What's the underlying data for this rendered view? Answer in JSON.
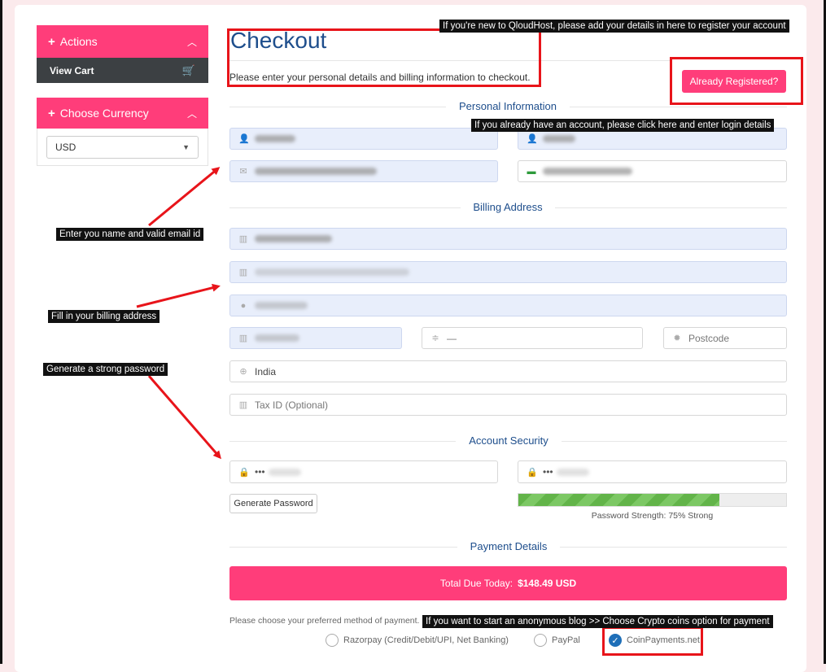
{
  "sidebar": {
    "actions_label": "Actions",
    "view_cart_label": "View Cart",
    "currency_label": "Choose Currency",
    "currency_value": "USD"
  },
  "main": {
    "title": "Checkout",
    "subtitle": "Please enter your personal details and billing information to checkout.",
    "already_registered": "Already Registered?",
    "sections": {
      "personal": "Personal Information",
      "billing": "Billing Address",
      "security": "Account Security",
      "payment": "Payment Details"
    },
    "fields": {
      "state_value": "—",
      "postcode_placeholder": "Postcode",
      "country_value": "India",
      "tax_placeholder": "Tax ID (Optional)",
      "password_mask": "•••",
      "password_confirm_mask": "•••"
    },
    "generate_password": "Generate Password",
    "password_strength": "Password Strength: 75% Strong",
    "password_strength_value": 0.75,
    "total_label": "Total Due Today:",
    "total_value": "$148.49 USD",
    "payment_prompt": "Please choose your preferred method of payment.",
    "payment_methods": [
      {
        "label": "Razorpay (Credit/Debit/UPI, Net Banking)",
        "selected": false
      },
      {
        "label": "PayPal",
        "selected": false
      },
      {
        "label": "CoinPayments.net",
        "selected": true
      }
    ]
  },
  "annotations": {
    "register": "If you're new to QloudHost, please add your details in here to register your account",
    "login": "If you already have an account, please click here and enter login details",
    "name_email": "Enter you name and valid email id",
    "billing": "Fill in your billing address",
    "password": "Generate a strong password",
    "crypto": "If you want to start an anonymous blog >> Choose Crypto coins option for payment"
  },
  "colors": {
    "accent": "#ff3d7a",
    "heading": "#1e4e8c",
    "annotation_red": "#e8141a",
    "strength_green": "#62b449"
  }
}
